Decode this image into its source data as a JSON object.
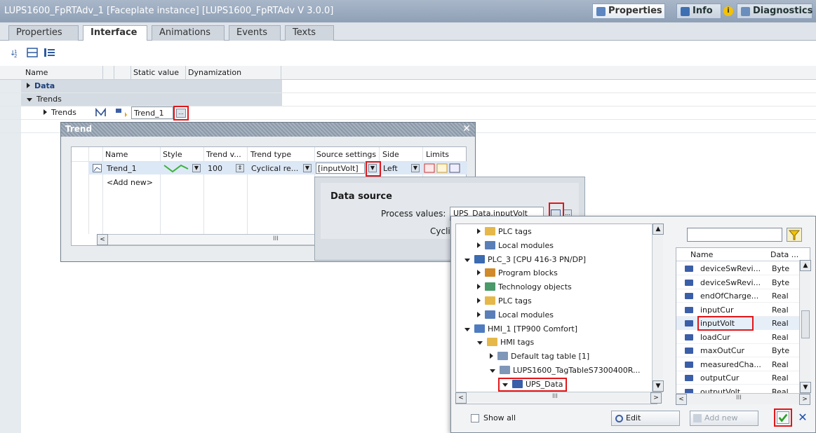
{
  "window": {
    "title": "LUPS1600_FpRTAdv_1 [Faceplate instance] [LUPS1600_FpRTAdv V 3.0.0]",
    "header_tabs": [
      "Properties",
      "Info",
      "Diagnostics"
    ]
  },
  "tabs": [
    "Properties",
    "Interface",
    "Animations",
    "Events",
    "Texts"
  ],
  "grid": {
    "columns": [
      "Name",
      "Static value",
      "Dynamization"
    ],
    "rows": [
      "Data",
      "Trends",
      "Trends"
    ],
    "trend_value": "Trend_1",
    "ellipsis": "..."
  },
  "trend_dialog": {
    "title": "Trend",
    "columns": [
      "Name",
      "Style",
      "Trend v...",
      "Trend type",
      "Source settings",
      "Side",
      "Limits"
    ],
    "row": {
      "name": "Trend_1",
      "trend_value": "100",
      "trend_type": "Cyclical re...",
      "source": "[inputVolt]",
      "side": "Left"
    },
    "add_new": "<Add new>",
    "scroll_mark": "III"
  },
  "data_source": {
    "title": "Data source",
    "process_label": "Process values:",
    "process_value": "UPS_Data.inputVolt",
    "cyclic_label": "Cyclic:"
  },
  "browser": {
    "tree": [
      {
        "label": "PLC tags",
        "indent": 1,
        "state": "collapsed",
        "icon": "folder-tags"
      },
      {
        "label": "Local modules",
        "indent": 1,
        "state": "collapsed",
        "icon": "modules"
      },
      {
        "label": "PLC_3 [CPU 416-3 PN/DP]",
        "indent": 0,
        "state": "expanded",
        "icon": "plc"
      },
      {
        "label": "Program blocks",
        "indent": 1,
        "state": "collapsed",
        "icon": "blocks"
      },
      {
        "label": "Technology objects",
        "indent": 1,
        "state": "collapsed",
        "icon": "tech"
      },
      {
        "label": "PLC tags",
        "indent": 1,
        "state": "collapsed",
        "icon": "folder-tags"
      },
      {
        "label": "Local modules",
        "indent": 1,
        "state": "collapsed",
        "icon": "modules"
      },
      {
        "label": "HMI_1 [TP900 Comfort]",
        "indent": 0,
        "state": "expanded",
        "icon": "hmi"
      },
      {
        "label": "HMI tags",
        "indent": 1,
        "state": "expanded",
        "icon": "folder-tags"
      },
      {
        "label": "Default tag table [1]",
        "indent": 2,
        "state": "collapsed",
        "icon": "table"
      },
      {
        "label": "LUPS1600_TagTableS7300400R...",
        "indent": 2,
        "state": "expanded",
        "icon": "table"
      },
      {
        "label": "UPS_Data",
        "indent": 3,
        "state": "expanded",
        "icon": "udt"
      }
    ],
    "tag_columns": [
      "Name",
      "Data ..."
    ],
    "tags": [
      {
        "name": "deviceSwRevi...",
        "type": "Byte"
      },
      {
        "name": "deviceSwRevi...",
        "type": "Byte"
      },
      {
        "name": "endOfCharge...",
        "type": "Real"
      },
      {
        "name": "inputCur",
        "type": "Real"
      },
      {
        "name": "inputVolt",
        "type": "Real"
      },
      {
        "name": "loadCur",
        "type": "Real"
      },
      {
        "name": "maxOutCur",
        "type": "Byte"
      },
      {
        "name": "measuredCha...",
        "type": "Real"
      },
      {
        "name": "outputCur",
        "type": "Real"
      },
      {
        "name": "outputVolt",
        "type": "Real"
      }
    ],
    "show_all": "Show all",
    "edit": "Edit",
    "add_new": "Add new",
    "scroll_mark": "III"
  },
  "colors": {
    "highlight": "#e0171b",
    "confirm": "#2aa02a",
    "cancel": "#1b4fa8"
  }
}
